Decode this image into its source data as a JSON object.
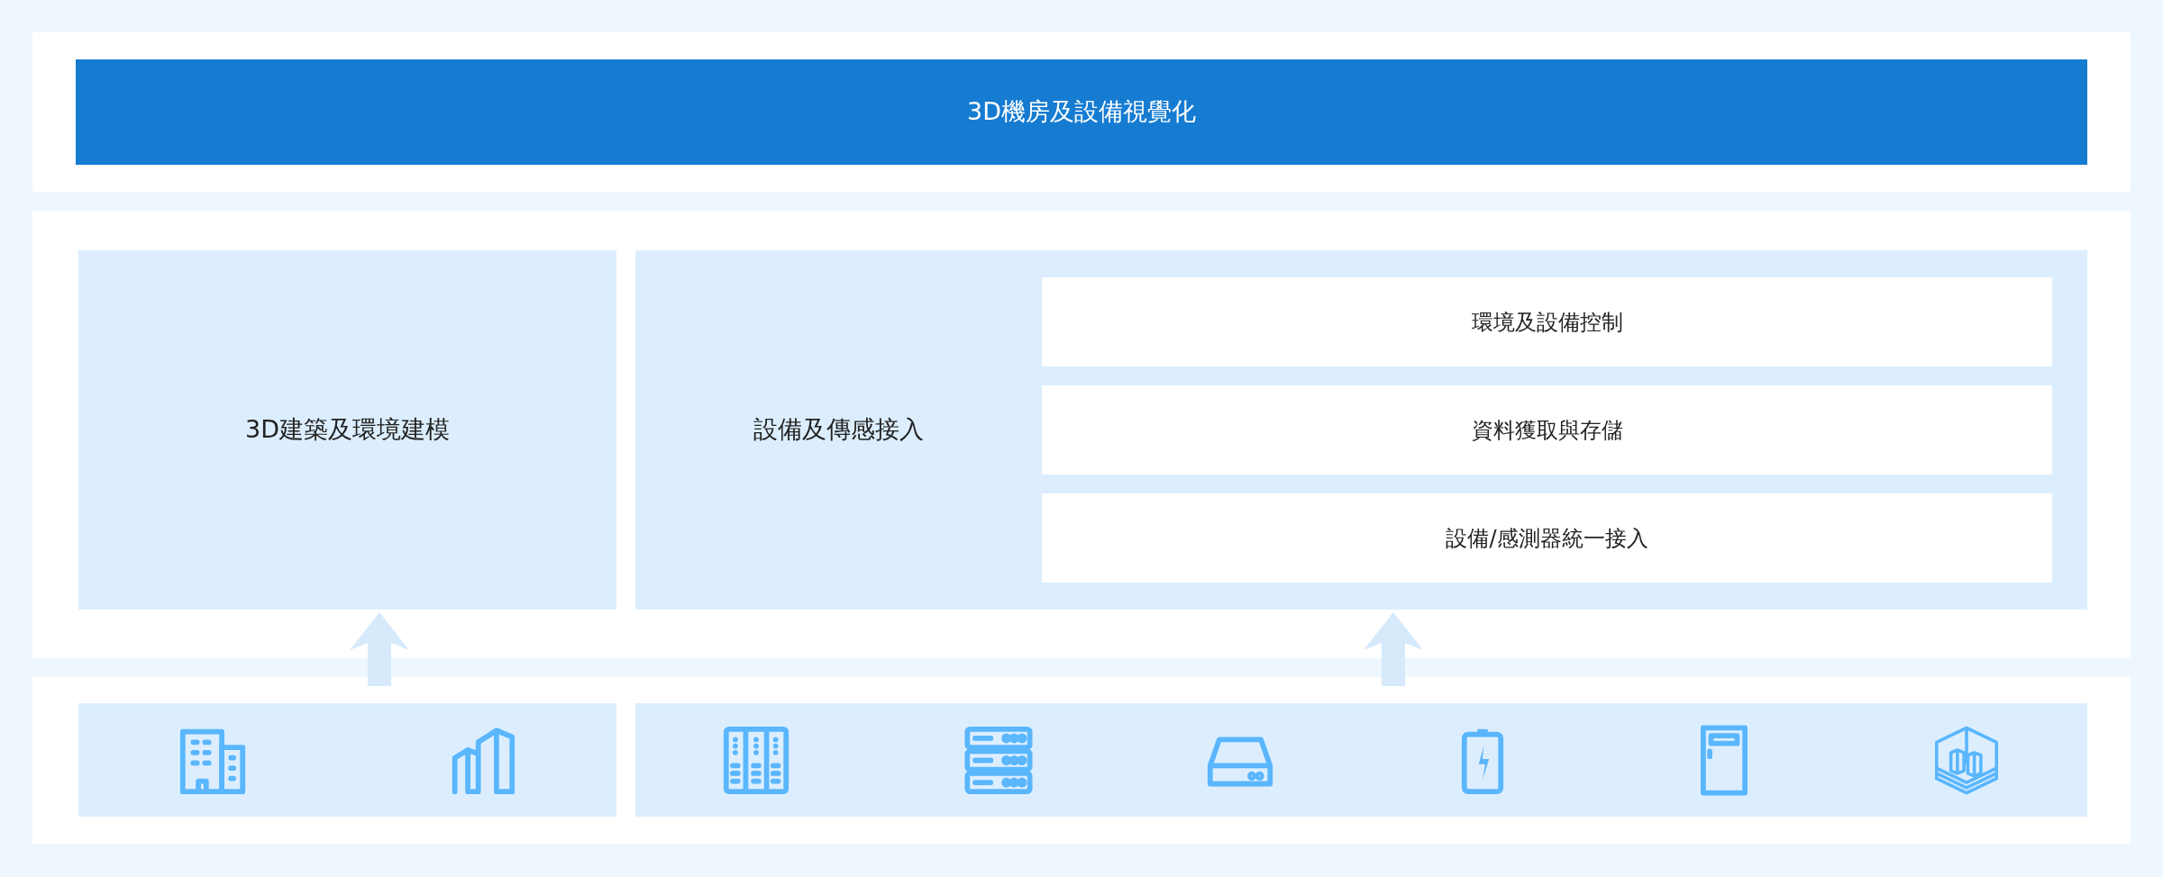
{
  "header": {
    "title": "3D機房及設備視覺化"
  },
  "modeling": {
    "label": "3D建築及環境建模"
  },
  "access": {
    "label": "設備及傳感接入",
    "layers": [
      {
        "label": "環境及設備控制"
      },
      {
        "label": "資料獲取與存儲"
      },
      {
        "label": "設備/感測器統一接入"
      }
    ]
  }
}
